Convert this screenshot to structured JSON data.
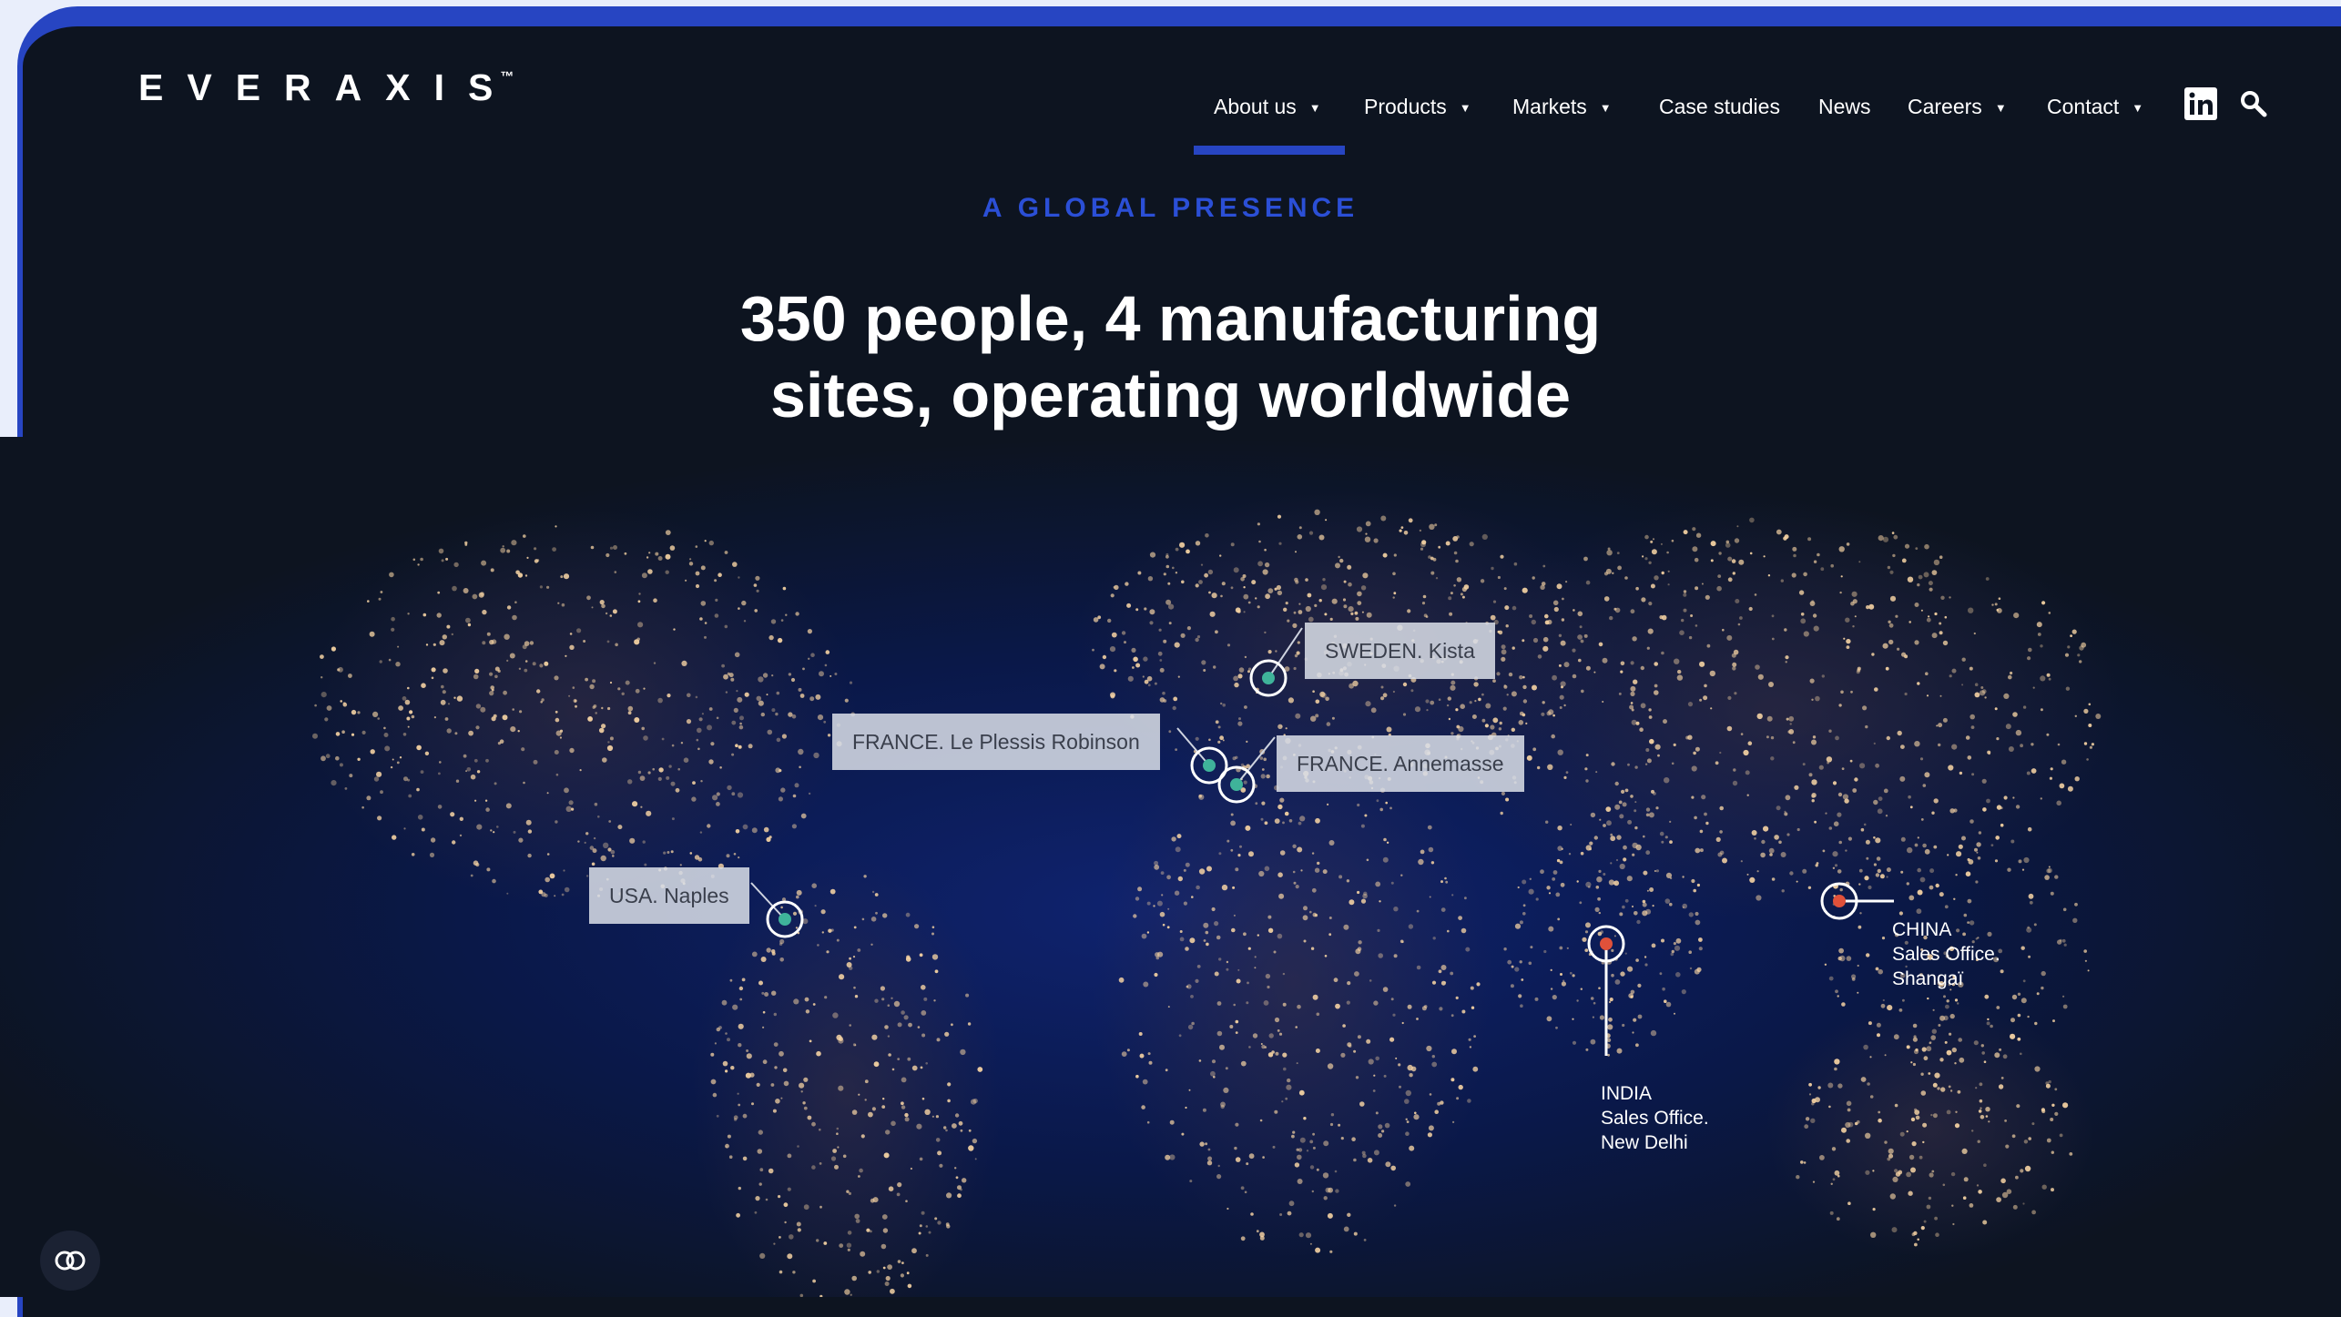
{
  "brand": {
    "logo_text": "EVERAXIS",
    "trademark": "™"
  },
  "nav": {
    "items": [
      {
        "label": "About us",
        "dropdown": true,
        "active": true
      },
      {
        "label": "Products",
        "dropdown": true
      },
      {
        "label": "Markets",
        "dropdown": true
      },
      {
        "label": "Case studies",
        "dropdown": false
      },
      {
        "label": "News",
        "dropdown": false
      },
      {
        "label": "Careers",
        "dropdown": true
      },
      {
        "label": "Contact",
        "dropdown": true
      }
    ],
    "caret": "▼",
    "linkedin_icon": "linkedin-icon",
    "search_icon": "search-icon"
  },
  "hero": {
    "eyebrow": "A GLOBAL PRESENCE",
    "headline_line1": "350 people, 4 manufacturing",
    "headline_line2": "sites, operating worldwide"
  },
  "map": {
    "locations": [
      {
        "label": "SWEDEN. Kista",
        "type": "manufacturing"
      },
      {
        "label": "FRANCE. Le Plessis Robinson",
        "type": "manufacturing"
      },
      {
        "label": "FRANCE. Annemasse",
        "type": "manufacturing"
      },
      {
        "label": "USA. Naples",
        "type": "manufacturing"
      },
      {
        "label": "INDIA\nSales Office.\nNew Delhi",
        "type": "sales"
      },
      {
        "label": "CHINA\nSales Office.\nShangaï",
        "type": "sales"
      }
    ]
  },
  "cookie_icon": "cookie-settings-icon",
  "colors": {
    "accent": "#2745c2",
    "background": "#0d1420",
    "manufacturing_marker": "#3fb39a",
    "sales_marker": "#e0513a",
    "city_lights": "#f4d2a3"
  }
}
